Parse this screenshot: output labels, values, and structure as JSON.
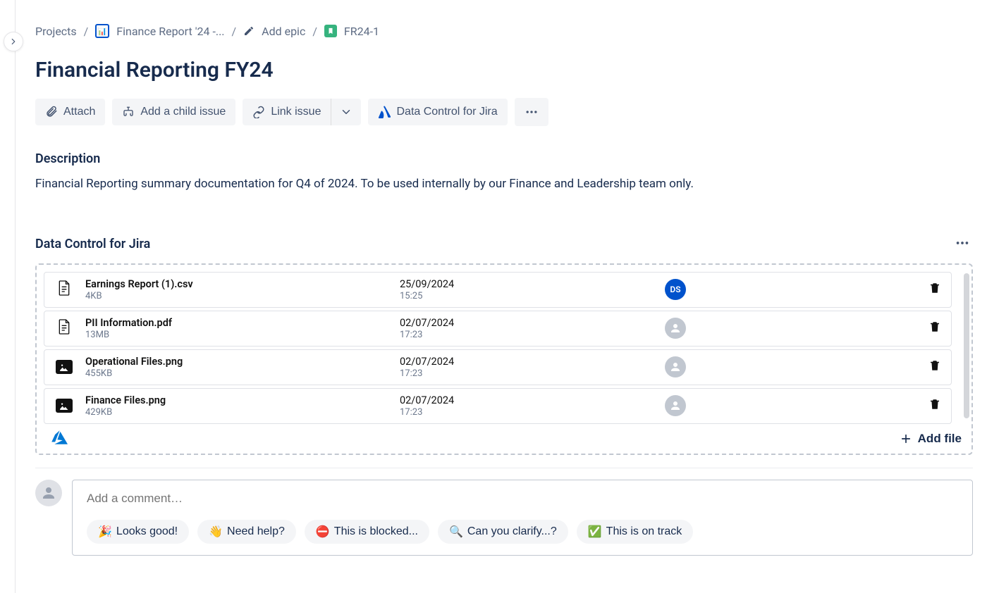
{
  "breadcrumb": {
    "projects": "Projects",
    "project_name": "Finance Report '24 -...",
    "add_epic": "Add epic",
    "issue_key": "FR24-1"
  },
  "title": "Financial Reporting FY24",
  "toolbar": {
    "attach": "Attach",
    "add_child": "Add a child issue",
    "link_issue": "Link issue",
    "data_control": "Data Control for Jira"
  },
  "description": {
    "heading": "Description",
    "body": "Financial Reporting summary documentation for Q4 of 2024. To be used internally by our Finance and Leadership team only."
  },
  "data_control": {
    "heading": "Data Control for Jira",
    "add_file": "Add file",
    "user_initials": "DS",
    "files": [
      {
        "name": "Earnings Report (1).csv",
        "size": "4KB",
        "date": "25/09/2024",
        "time": "15:25",
        "icon": "doc",
        "user": "ds"
      },
      {
        "name": "PII Information.pdf",
        "size": "13MB",
        "date": "02/07/2024",
        "time": "17:23",
        "icon": "doc",
        "user": "blank"
      },
      {
        "name": "Operational Files.png",
        "size": "455KB",
        "date": "02/07/2024",
        "time": "17:23",
        "icon": "image",
        "user": "blank"
      },
      {
        "name": "Finance Files.png",
        "size": "429KB",
        "date": "02/07/2024",
        "time": "17:23",
        "icon": "image",
        "user": "blank"
      }
    ]
  },
  "comment": {
    "placeholder": "Add a comment…",
    "reactions": [
      {
        "emoji": "🎉",
        "label": "Looks good!"
      },
      {
        "emoji": "👋",
        "label": "Need help?"
      },
      {
        "emoji": "⛔",
        "label": "This is blocked..."
      },
      {
        "emoji": "🔍",
        "label": "Can you clarify...?"
      },
      {
        "emoji": "✅",
        "label": "This is on track"
      }
    ]
  }
}
